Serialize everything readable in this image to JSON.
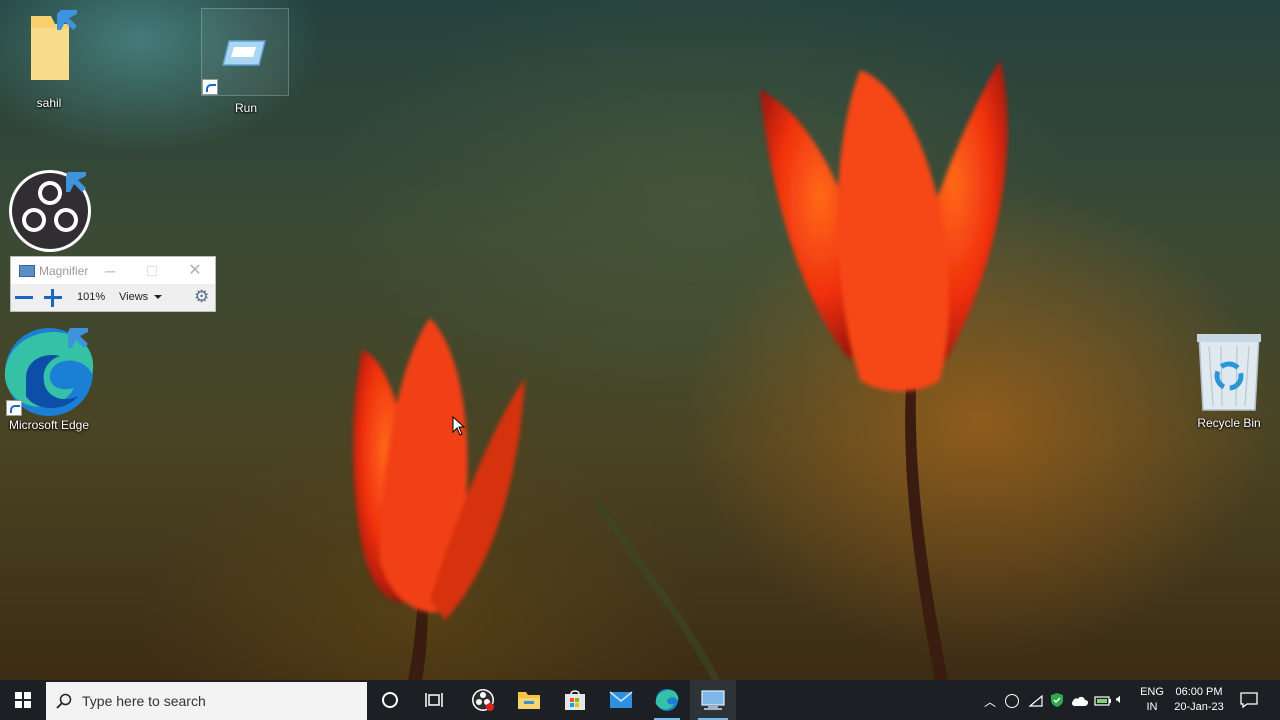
{
  "desktop": {
    "icons": [
      {
        "label": "sahil"
      },
      {
        "label": "Run"
      },
      {
        "label": "Microsoft Edge"
      },
      {
        "label": "Recycle Bin"
      }
    ]
  },
  "magnifier": {
    "title": "Magnifier",
    "zoom": "101%",
    "views_label": "Views"
  },
  "taskbar": {
    "search_placeholder": "Type here to search",
    "language": {
      "line1": "ENG",
      "line2": "IN"
    },
    "clock": {
      "time": "06:00 PM",
      "date": "20-Jan-23"
    }
  },
  "colors": {
    "taskbar": "#1c2024",
    "accent": "#1a66c2",
    "running_indicator": "#76b9ed"
  }
}
